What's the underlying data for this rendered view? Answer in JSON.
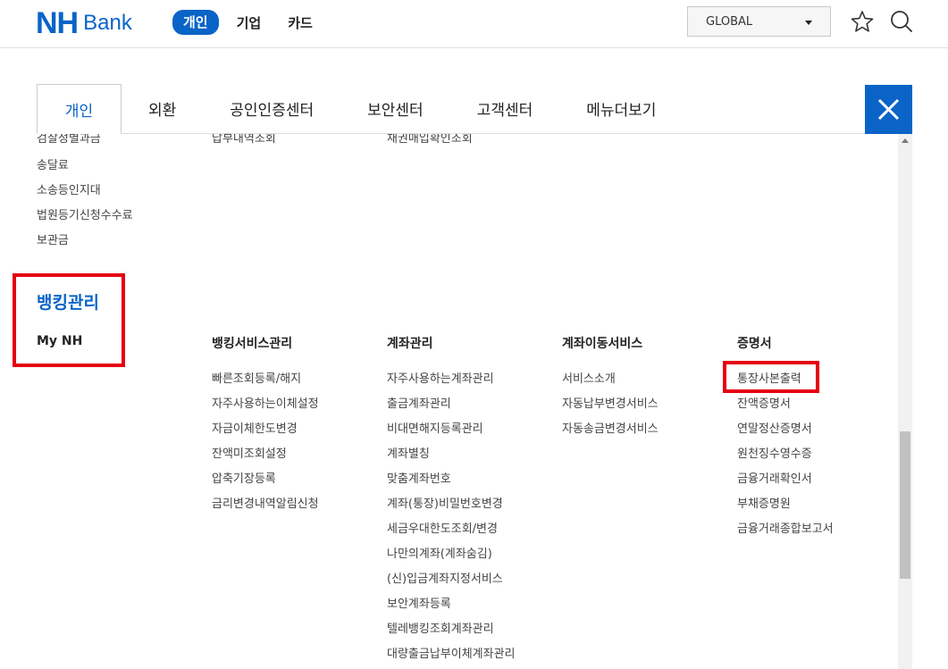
{
  "header": {
    "logo_nh": "NH",
    "logo_bank": "Bank",
    "nav": [
      "개인",
      "기업",
      "카드"
    ],
    "global_select": "GLOBAL",
    "icons": [
      "star-icon",
      "search-icon"
    ],
    "brand_color": "#0a64c8"
  },
  "tabs": [
    "개인",
    "외환",
    "공인인증센터",
    "보안센터",
    "고객센터",
    "메뉴더보기"
  ],
  "close_icon": "close-icon",
  "top_rows": {
    "col1": [
      "검찰정별과금",
      "송달료",
      "소송등인지대",
      "법원등기신청수수료",
      "보관금"
    ],
    "col2": [
      "납부내역조회"
    ],
    "col3": [
      "채권매입확인조회"
    ]
  },
  "section": {
    "title": "뱅킹관리",
    "sub": "My NH"
  },
  "columns": [
    {
      "heading": "뱅킹서비스관리",
      "items": [
        "빠른조회등록/해지",
        "자주사용하는이체설정",
        "자금이체한도변경",
        "잔액미조회설정",
        "압축기장등록",
        "금리변경내역알림신청"
      ]
    },
    {
      "heading": "계좌관리",
      "items": [
        "자주사용하는계좌관리",
        "출금계좌관리",
        "비대면해지등록관리",
        "계좌별칭",
        "맞춤계좌번호",
        "계좌(통장)비밀번호변경",
        "세금우대한도조회/변경",
        "나만의계좌(계좌숨김)",
        "(신)입금계좌지정서비스",
        "보안계좌등록",
        "텔레뱅킹조회계좌관리",
        "대량출금납부이체계좌관리"
      ]
    },
    {
      "heading": "계좌이동서비스",
      "items": [
        "서비스소개",
        "자동납부변경서비스",
        "자동송금변경서비스"
      ]
    },
    {
      "heading": "증명서",
      "items": [
        "통장사본출력",
        "잔액증명서",
        "연말정산증명서",
        "원천징수영수증",
        "금융거래확인서",
        "부채증명원",
        "금융거래종합보고서"
      ]
    }
  ],
  "highlight_color": "#e50012"
}
